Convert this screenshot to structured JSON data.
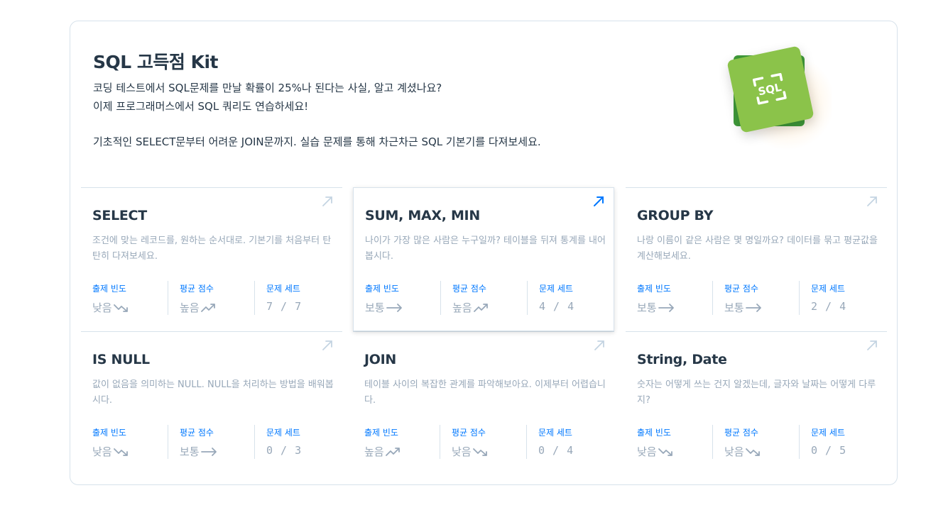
{
  "hero": {
    "title": "SQL 고득점 Kit",
    "line1": "코딩 테스트에서 SQL문제를 만날 확률이 25%나 된다는 사실, 알고 계셨나요?",
    "line2": "이제 프로그래머스에서 SQL 쿼리도 연습하세요!",
    "line3": "기초적인 SELECT문부터 어려운 JOIN문까지. 실습 문제를 통해 차근차근 SQL 기본기를 다져보세요.",
    "logo_icon": "sql-badge-icon",
    "logo_colors": {
      "front": "#8bc34a",
      "back": "#3f9a3a"
    }
  },
  "labels": {
    "freq": "출제 빈도",
    "score": "평균 점수",
    "sets": "문제 세트"
  },
  "colors": {
    "accent": "#0078ff",
    "muted": "#98a8b9",
    "text": "#263747"
  },
  "cards": [
    {
      "title": "SELECT",
      "desc": "조건에 맞는 레코드를, 원하는 순서대로. 기본기를 처음부터 탄탄히 다져보세요.",
      "freq": "낮음",
      "freq_icon": "trend-down-icon",
      "score": "높음",
      "score_icon": "trend-up-icon",
      "sets": "7 / 7"
    },
    {
      "title": "SUM, MAX, MIN",
      "desc": "나이가 가장 많은 사람은 누구일까? 테이블을 뒤져 통계를 내어봅시다.",
      "freq": "보통",
      "freq_icon": "trend-flat-icon",
      "score": "높음",
      "score_icon": "trend-up-icon",
      "sets": "4 / 4"
    },
    {
      "title": "GROUP BY",
      "desc": "나랑 이름이 같은 사람은 몇 명일까요? 데이터를 묶고 평균값을 계산해보세요.",
      "freq": "보통",
      "freq_icon": "trend-flat-icon",
      "score": "보통",
      "score_icon": "trend-flat-icon",
      "sets": "2 / 4"
    },
    {
      "title": "IS NULL",
      "desc": "값이 없음을 의미하는 NULL. NULL을 처리하는 방법을 배워봅시다.",
      "freq": "낮음",
      "freq_icon": "trend-down-icon",
      "score": "보통",
      "score_icon": "trend-flat-icon",
      "sets": "0 / 3"
    },
    {
      "title": "JOIN",
      "desc": "테이블 사이의 복잡한 관계를 파악해보아요. 이제부터 어렵습니다.",
      "freq": "높음",
      "freq_icon": "trend-up-icon",
      "score": "낮음",
      "score_icon": "trend-down-icon",
      "sets": "0 / 4"
    },
    {
      "title": "String, Date",
      "desc": "숫자는 어떻게 쓰는 건지 알겠는데, 글자와 날짜는 어떻게 다루지?",
      "freq": "낮음",
      "freq_icon": "trend-down-icon",
      "score": "낮음",
      "score_icon": "trend-down-icon",
      "sets": "0 / 5"
    }
  ]
}
